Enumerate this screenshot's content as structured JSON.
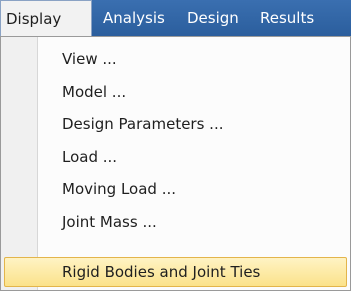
{
  "menubar": {
    "items": [
      {
        "label": "Display"
      },
      {
        "label": "Analysis"
      },
      {
        "label": "Design"
      },
      {
        "label": "Results"
      }
    ]
  },
  "display_menu": {
    "items": [
      {
        "label": "View ..."
      },
      {
        "label": "Model ..."
      },
      {
        "label": "Design Parameters ..."
      },
      {
        "label": "Load ..."
      },
      {
        "label": "Moving Load ..."
      },
      {
        "label": "Joint Mass ..."
      },
      {
        "label": "Rigid Bodies and Joint Ties",
        "highlighted": true
      }
    ]
  },
  "colors": {
    "menubar_bg": "#2b5e9d",
    "highlight_bg": "#fbe28a",
    "highlight_border": "#e3b54b"
  }
}
